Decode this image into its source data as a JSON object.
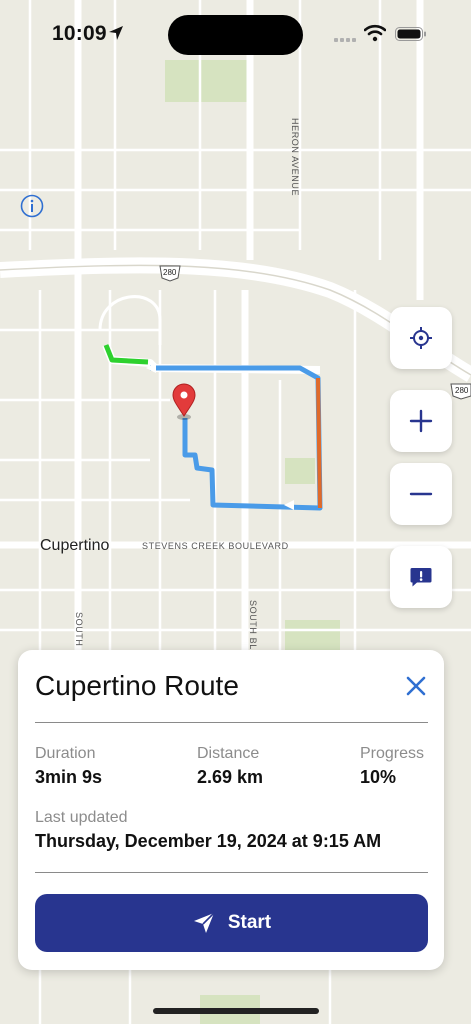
{
  "status_bar": {
    "time": "10:09"
  },
  "map": {
    "labels": {
      "city": "Cupertino",
      "stevens_creek": "STEVENS CREEK BOULEVARD",
      "heron_avenue": "HERON AVENUE",
      "highway_280": "280",
      "highway_280b": "280",
      "south_a": "SOUTH B",
      "south_b": "SOUTH BL"
    },
    "route_color": "#4a9be8",
    "route_start_color": "#2ed12e",
    "route_alert_color": "#e06a2a",
    "pin_color": "#e23b3b"
  },
  "controls": {
    "locate_icon": "crosshair-icon",
    "zoom_in_icon": "plus-icon",
    "zoom_out_icon": "minus-icon",
    "feedback_icon": "alert-bubble-icon"
  },
  "route_card": {
    "title": "Cupertino Route",
    "duration_label": "Duration",
    "duration_value": "3min 9s",
    "distance_label": "Distance",
    "distance_value": "2.69 km",
    "progress_label": "Progress",
    "progress_value": "10%",
    "updated_label": "Last updated",
    "updated_value": "Thursday, December 19, 2024 at 9:15 AM",
    "start_label": "Start",
    "accent_color": "#28358f"
  }
}
